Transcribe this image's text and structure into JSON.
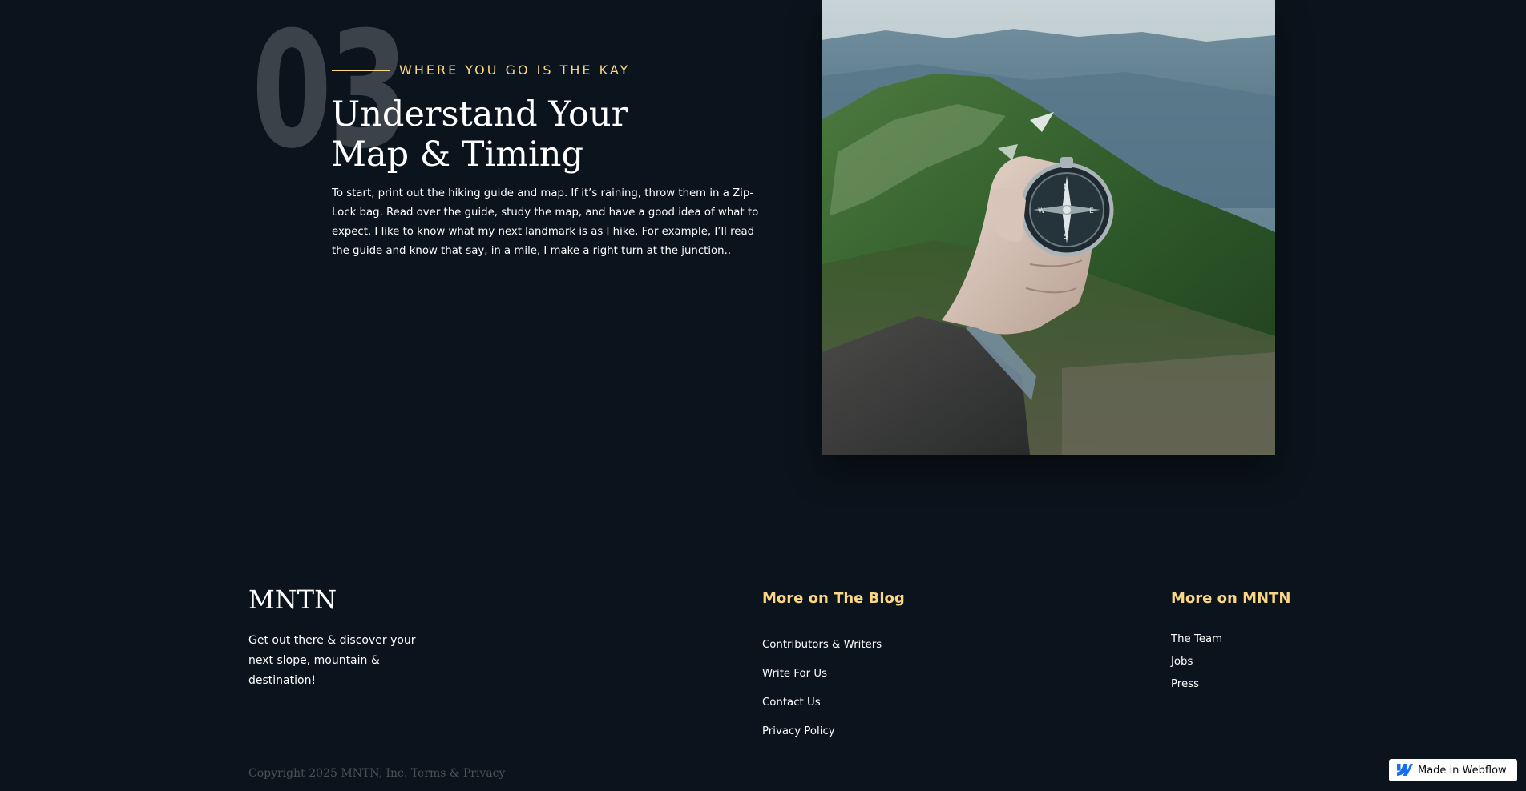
{
  "section": {
    "number": "03",
    "eyebrow": "WHERE YOU GO IS THE KAY",
    "heading_line1": "Understand Your",
    "heading_line2": "Map & Timing",
    "body": "To start, print out the hiking guide and map. If it’s raining, throw them in a Zip-Lock bag. Read over the guide, study the map, and have a good idea of what to expect. I like to know what my next landmark is as I hike. For example, I’ll read the guide and know that say, in a mile, I make a right turn at the junction..",
    "image_alt": "hand-holding-compass-on-mountain-ridge"
  },
  "footer": {
    "brand": "MNTN",
    "tagline": "Get out there & discover your next slope, mountain & destination!",
    "blog_title": "More on The Blog",
    "blog_links": [
      "Contributors & Writers",
      "Write For Us",
      "Contact Us",
      "Privacy Policy"
    ],
    "mntn_title": "More on MNTN",
    "mntn_links": [
      "The Team",
      "Jobs",
      "Press"
    ],
    "copyright": "Copyright 2025 MNTN, Inc. Terms & Privacy"
  },
  "badge": {
    "label": "Made in Webflow",
    "icon": "webflow-logo-icon"
  },
  "colors": {
    "background": "#0b141c",
    "accent": "#fbd784",
    "number": "#3b4249",
    "muted": "#4b5156"
  }
}
